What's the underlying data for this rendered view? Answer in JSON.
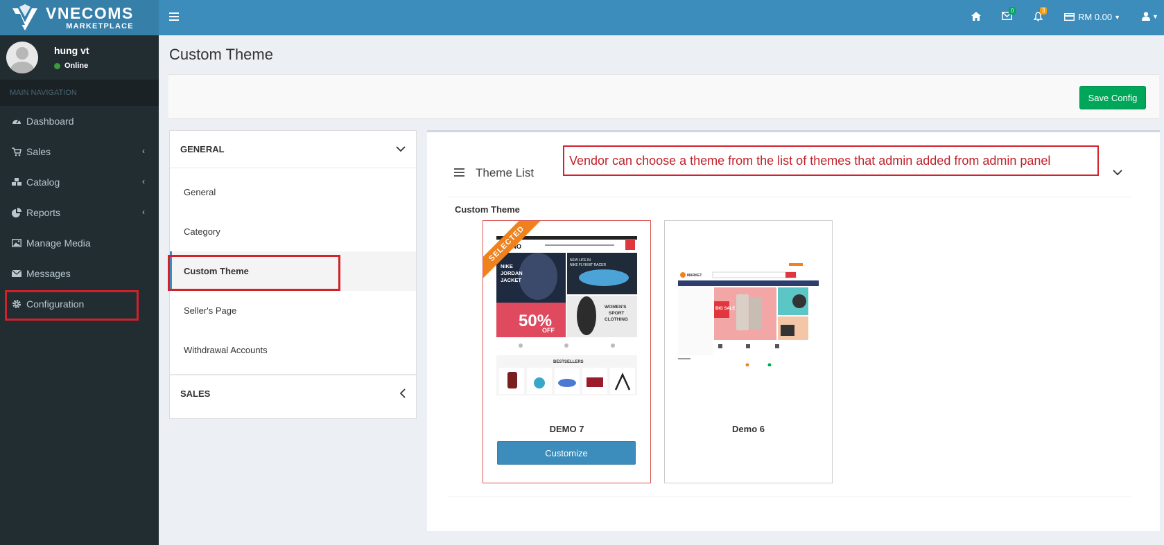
{
  "brand": {
    "name": "VNECOMS",
    "tagline": "MARKETPLACE"
  },
  "user": {
    "name": "hung vt",
    "status": "Online"
  },
  "sidebar": {
    "header": "MAIN NAVIGATION",
    "items": [
      {
        "label": "Dashboard",
        "icon": "dashboard-icon"
      },
      {
        "label": "Sales",
        "icon": "cart-icon"
      },
      {
        "label": "Catalog",
        "icon": "cubes-icon"
      },
      {
        "label": "Reports",
        "icon": "pie-chart-icon"
      },
      {
        "label": "Manage Media",
        "icon": "image-icon"
      },
      {
        "label": "Messages",
        "icon": "envelope-icon"
      },
      {
        "label": "Configuration",
        "icon": "gear-icon"
      }
    ]
  },
  "topbar": {
    "messages_count": "0",
    "notifications_count": "3",
    "balance": "RM 0.00"
  },
  "page": {
    "title": "Custom Theme",
    "save_label": "Save Config"
  },
  "config_menu": {
    "general_header": "GENERAL",
    "items": [
      "General",
      "Category",
      "Custom Theme",
      "Seller's Page",
      "Withdrawal Accounts"
    ],
    "sales_header": "SALES"
  },
  "themes": {
    "panel_title": "Theme List",
    "annotation": "Vendor can choose a theme from the list of themes that admin added from admin panel",
    "section_label": "Custom Theme",
    "cards": [
      {
        "name": "DEMO 7",
        "ribbon": "SELECTED",
        "button": "Customize"
      },
      {
        "name": "Demo 6"
      }
    ],
    "demo7_preview": {
      "logo": "INO",
      "hero_left": "NIKE JORDAN JACKET",
      "hero_right_top": "NEW LIFE IN NIKE FLYKNIT RACER",
      "hero_right_bottom": "WOMEN'S SPORT CLOTHING",
      "sale": "50%",
      "sale_sub": "OFF",
      "bestsellers": "BESTSELLERS"
    },
    "demo6_preview": {
      "logo": "MARKET",
      "sale": "BIG SALE"
    }
  },
  "colors": {
    "sidebar": "#222d32",
    "topbar": "#3c8dbc",
    "save": "#00a65a",
    "highlight": "#d1212b",
    "ribbon": "#f0821e"
  }
}
